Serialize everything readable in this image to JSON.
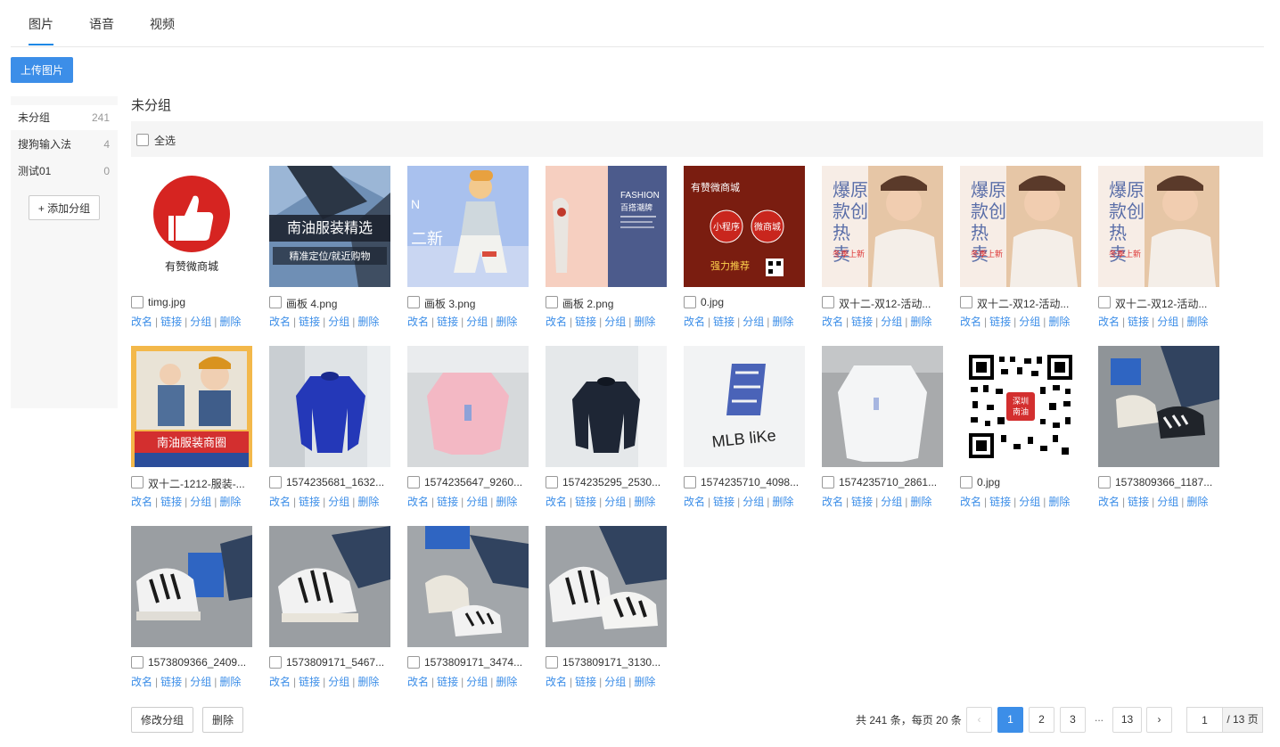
{
  "tabs": [
    {
      "label": "图片"
    },
    {
      "label": "语音"
    },
    {
      "label": "视频"
    }
  ],
  "upload_label": "上传图片",
  "groups": [
    {
      "name": "未分组",
      "count": "241"
    },
    {
      "name": "搜狗输入法",
      "count": "4"
    },
    {
      "name": "测试01",
      "count": "0"
    }
  ],
  "add_group_label": "+ 添加分组",
  "current_group": "未分组",
  "select_all_label": "全选",
  "actions": {
    "rename": "改名",
    "link": "链接",
    "group": "分组",
    "delete": "删除",
    "sep": "|"
  },
  "images": [
    {
      "name": "timg.jpg",
      "texts": [
        "有赞微商城"
      ]
    },
    {
      "name": "画板 4.png",
      "texts": [
        "南油服装精选",
        "精准定位/就近购物"
      ]
    },
    {
      "name": "画板 3.png",
      "texts": [
        "二新",
        "N"
      ]
    },
    {
      "name": "画板 2.png",
      "texts": [
        "FASHION",
        "百搭潮牌"
      ]
    },
    {
      "name": "0.jpg",
      "texts": [
        "有赞微商城",
        "小程序",
        "微商城",
        "强力推荐"
      ]
    },
    {
      "name": "双十二-双12-活动...",
      "texts": [
        "爆原",
        "款创",
        "热",
        "卖",
        "冬季上新"
      ]
    },
    {
      "name": "双十二-双12-活动...",
      "texts": [
        "爆原",
        "款创",
        "热",
        "卖",
        "冬季上新"
      ]
    },
    {
      "name": "双十二-双12-活动...",
      "texts": [
        "爆原",
        "款创",
        "热",
        "卖",
        "冬季上新"
      ]
    },
    {
      "name": "双十二-1212-服装-...",
      "texts": [
        "南油服装商圈"
      ]
    },
    {
      "name": "1574235681_1632...",
      "texts": []
    },
    {
      "name": "1574235647_9260...",
      "texts": []
    },
    {
      "name": "1574235295_2530...",
      "texts": []
    },
    {
      "name": "1574235710_4098...",
      "texts": [
        "MLB liKe"
      ]
    },
    {
      "name": "1574235710_2861...",
      "texts": []
    },
    {
      "name": "0.jpg",
      "texts": [
        "深圳",
        "南油"
      ]
    },
    {
      "name": "1573809366_1187...",
      "texts": []
    },
    {
      "name": "1573809366_2409...",
      "texts": []
    },
    {
      "name": "1573809171_5467...",
      "texts": []
    },
    {
      "name": "1573809171_3474...",
      "texts": []
    },
    {
      "name": "1573809171_3130...",
      "texts": []
    }
  ],
  "bottom": {
    "modify_group_label": "修改分组",
    "delete_label": "删除"
  },
  "pagination": {
    "summary": "共 241 条，每页 20 条",
    "prev": "‹",
    "next": "›",
    "pages": [
      "1",
      "2",
      "3",
      "13"
    ],
    "ellipsis": "...",
    "current_page": "1",
    "jump_value": "1",
    "total_pages_label": "/ 13 页"
  },
  "colors": {
    "accent": "#3c8ee8",
    "link": "#3c8ee8"
  }
}
